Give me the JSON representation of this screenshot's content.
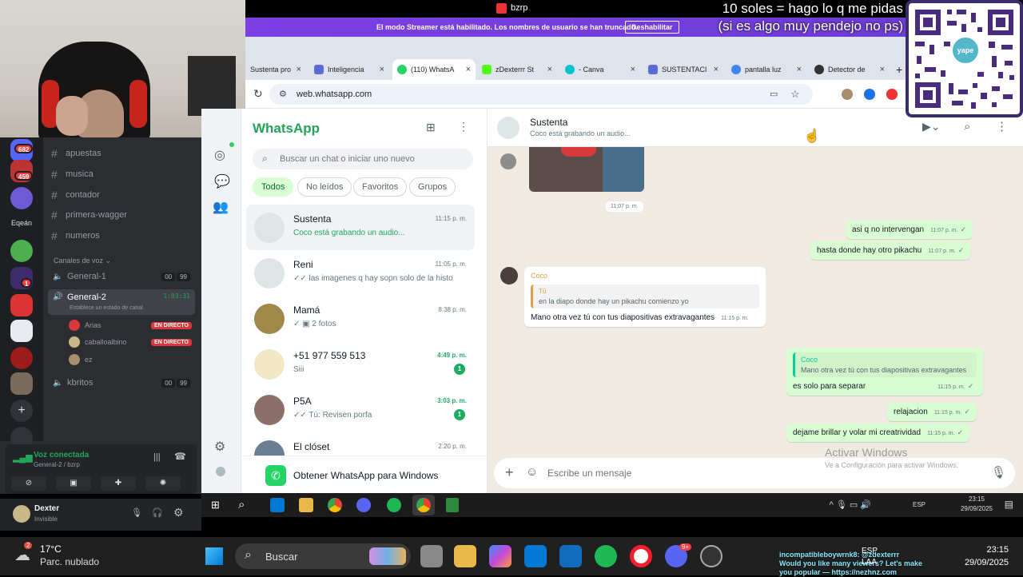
{
  "overlay": {
    "line1": "10 soles = hago lo q me pidas",
    "line2": "(si es algo muy pendejo no ps)",
    "qr_logo": "yape"
  },
  "browser": {
    "window_title": "bzrp",
    "streamer_banner": "El modo Streamer está habilitado. Los nombres de usuario se han truncado.",
    "streamer_button": "Deshabilitar",
    "url": "web.whatsapp.com",
    "tabs": [
      {
        "label": "Sustenta pro",
        "color": "#6c63ff"
      },
      {
        "label": "Inteligencia",
        "color": "#5b6bd6"
      },
      {
        "label": "(110) WhatsA",
        "color": "#25d366"
      },
      {
        "label": "zDexterrr St",
        "color": "#53fc18"
      },
      {
        "label": "- Canva",
        "color": "#00c4cc"
      },
      {
        "label": "SUSTENTACI",
        "color": "#5b6bd6"
      },
      {
        "label": "pantalla luz",
        "color": "#4285f4"
      },
      {
        "label": "Detector de",
        "color": "#333333"
      }
    ]
  },
  "discord": {
    "badges": [
      "682",
      "459",
      "1"
    ],
    "server_label": "Eqeán",
    "text_channels": [
      "apuestas",
      "musica",
      "contador",
      "primera-wagger",
      "numeros"
    ],
    "voice_header": "Canales de voz",
    "voice_channels": [
      {
        "name": "General-1",
        "count": "00",
        "limit": "99"
      },
      {
        "name": "General-2",
        "timer": "1:03:31",
        "status": "Establece un estado de canal"
      },
      {
        "name": "kbritos",
        "count": "00",
        "limit": "99"
      }
    ],
    "voice_users": [
      {
        "name": "Arias",
        "live": "EN DIRECTO"
      },
      {
        "name": "caballoalbino",
        "live": "EN DIRECTO"
      },
      {
        "name": "ez",
        "live": ""
      }
    ],
    "voice_connected": "Voz conectada",
    "voice_location": "General-2 / bzrp",
    "user_name": "Dexter",
    "user_status": "Invisible"
  },
  "whatsapp": {
    "brand": "WhatsApp",
    "search_placeholder": "Buscar un chat o iniciar uno nuevo",
    "filters": [
      "Todos",
      "No leídos",
      "Favoritos",
      "Grupos"
    ],
    "chats": [
      {
        "name": "Sustenta",
        "time": "11:15 p. m.",
        "preview": "Coco está grabando un audio...",
        "unread": ""
      },
      {
        "name": "Reni",
        "time": "11:05 p. m.",
        "preview": "✓✓ las imagenes q hay sopn solo de la histo...",
        "unread": ""
      },
      {
        "name": "Mamá",
        "time": "8:38 p. m.",
        "preview": "✓ ▣ 2 fotos",
        "unread": ""
      },
      {
        "name": "+51 977 559 513",
        "time": "4:49 p. m.",
        "preview": "Siii",
        "unread": "1"
      },
      {
        "name": "P5A",
        "time": "3:03 p. m.",
        "preview": "✓✓ Tú: Revisen porfa",
        "unread": "1"
      },
      {
        "name": "El clóset",
        "time": "2:20 p. m.",
        "preview": "",
        "unread": ""
      }
    ],
    "get_windows": "Obtener WhatsApp para Windows",
    "conversation": {
      "title": "Sustenta",
      "status": "Coco está grabando un audio...",
      "image_time": "11:07 p. m.",
      "out1": {
        "text": "asi q no intervengan",
        "time": "11:07 p. m."
      },
      "out2": {
        "text": "hasta donde hay otro pikachu",
        "time": "11:07 p. m."
      },
      "in1": {
        "sender": "Coco",
        "quote_author": "Tú",
        "quote_text": "en la diapo donde hay un pikachu comienzo yo",
        "text": "Mano otra vez tú con tus diapositivas extravagantes",
        "time": "11:15 p. m."
      },
      "out3": {
        "quote_author": "Coco",
        "quote_text": "Mano otra vez tú con tus diapositivas extravagantes",
        "text": "es solo para separar",
        "time": "11:15 p. m."
      },
      "out4": {
        "text": "relajacion",
        "time": "11:15 p. m."
      },
      "out5": {
        "text": "dejame brillar y volar mi creatrividad",
        "time": "11:15 p. m."
      },
      "composer_placeholder": "Escribe un mensaje"
    },
    "activate_title": "Activar Windows",
    "activate_sub": "Ve a Configuración para activar Windows."
  },
  "vm_taskbar": {
    "lang": "ESP",
    "time": "23:15",
    "date": "29/09/2025"
  },
  "taskbar": {
    "weather_badge": "2",
    "temp": "17°C",
    "weather": "Parc. nublado",
    "search": "Buscar",
    "discord_badge": "9+",
    "ticker_a": "incompatibleboywrnk8: @zdexterrr Would you like many viewers? Let's make you popular — https://nezhnz.com",
    "lang1": "ESP",
    "lang2": "LAA",
    "time": "23:15",
    "date": "29/09/2025"
  }
}
